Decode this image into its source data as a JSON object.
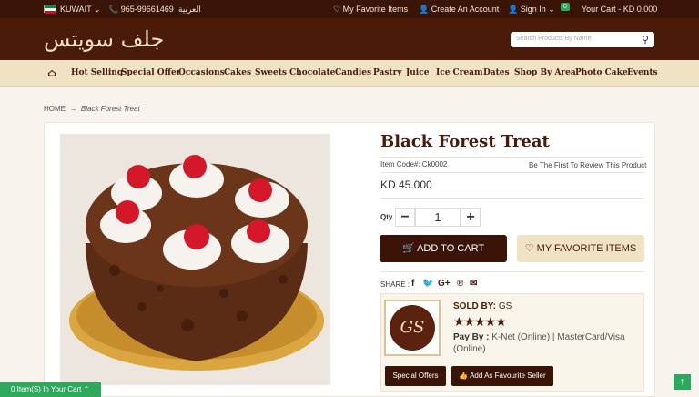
{
  "topbar": {
    "country": "KUWAIT",
    "phone": "965-99661469",
    "language": "العربية",
    "favorites": "My Favorite Items",
    "create_account": "Create An Account",
    "sign_in": "Sign In",
    "cart_count": "0",
    "cart_label": "Your Cart",
    "cart_total": "KD 0.000"
  },
  "header": {
    "logo": "جلف سويتس",
    "search_placeholder": "Search Products By Name"
  },
  "nav": [
    "Hot Selling",
    "Special Offer",
    "Occasions",
    "Cakes",
    "Sweets",
    "Chocolate",
    "Candies",
    "Pastry",
    "Juice",
    "Ice Cream",
    "Dates",
    "Shop By Area",
    "Photo Cake",
    "Events"
  ],
  "breadcrumb": {
    "home": "HOME",
    "arrow": "→",
    "current": "Black Forest Treat"
  },
  "product": {
    "title": "Black Forest Treat",
    "item_code": "Item Code#: Ck0002",
    "review": "Be The First To Review This Product",
    "price": "KD 45.000",
    "qty_label": "Qty",
    "qty": "1",
    "add_to_cart": "ADD TO CART",
    "favorite": "MY FAVORITE ITEMS",
    "share_label": "SHARE :"
  },
  "seller": {
    "logo_text": "GS",
    "sold_by_label": "SOLD BY:",
    "sold_by": "GS",
    "stars": "★★★★★",
    "pay_label": "Pay By :",
    "pay_methods": "K-Net (Online) | MasterCard/Visa (Online)",
    "special_offers": "Special Offers",
    "add_favourite": "Add As Favourite Seller"
  },
  "footer": {
    "cart_items": "0 Item(S) In Your Cart",
    "up": "↑"
  }
}
